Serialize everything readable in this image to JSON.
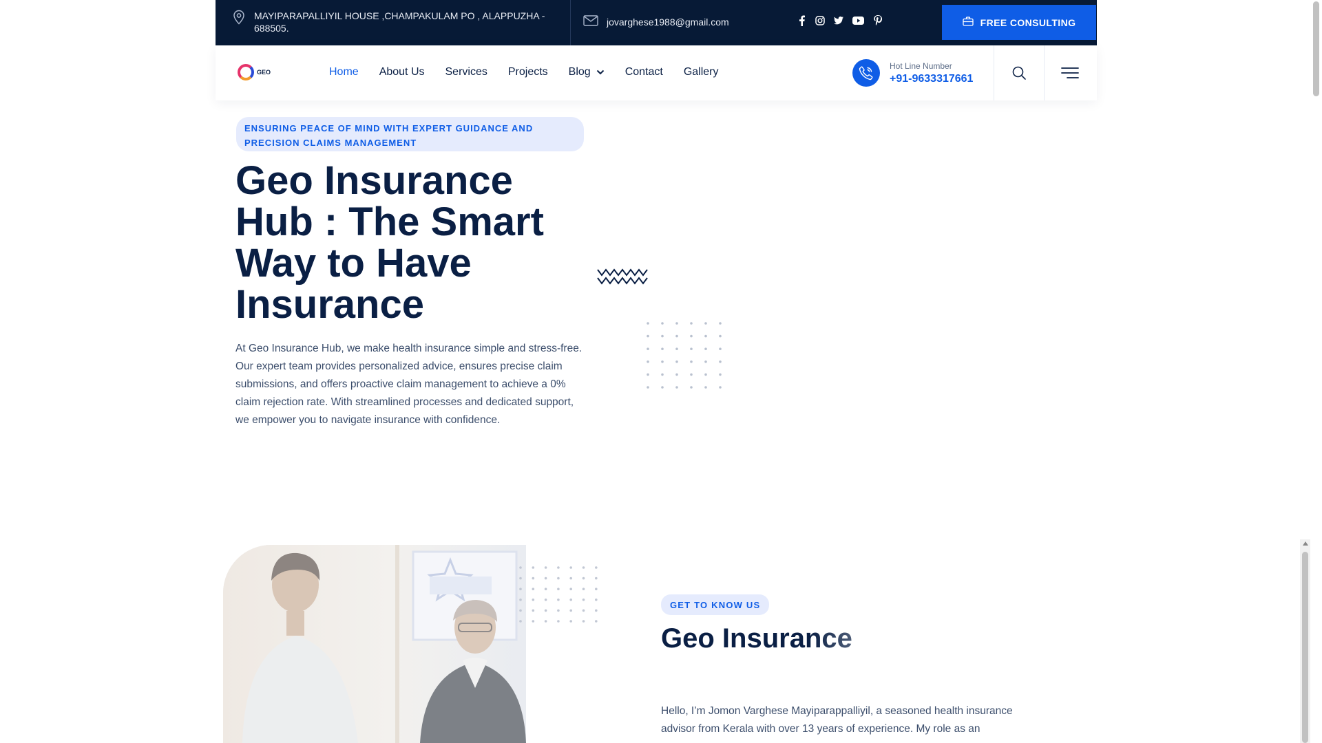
{
  "topbar": {
    "address": "MAYIPARAPALLIYIL HOUSE ,CHAMPAKULAM PO , ALAPPUZHA - 688505.",
    "email": "jovarghese1988@gmail.com",
    "social_icons": [
      "facebook-icon",
      "instagram-icon",
      "twitter-icon",
      "youtube-icon",
      "pinterest-icon"
    ],
    "cta_label": "FREE CONSULTING"
  },
  "header": {
    "logo_text": "GEO",
    "nav": [
      {
        "label": "Home",
        "active": true
      },
      {
        "label": "About Us"
      },
      {
        "label": "Services"
      },
      {
        "label": "Projects"
      },
      {
        "label": "Blog",
        "has_dropdown": true
      },
      {
        "label": "Contact"
      },
      {
        "label": "Gallery"
      }
    ],
    "hotline_label": "Hot Line Number",
    "hotline_number": "+91-9633317661"
  },
  "hero": {
    "tag": "ENSURING PEACE OF MIND WITH EXPERT GUIDANCE AND PRECISION CLAIMS MANAGEMENT",
    "title": "Geo Insurance Hub : The Smart Way to Have Insurance",
    "description": "At Geo Insurance Hub, we make health insurance simple and stress-free. Our expert team provides personalized advice, ensures precise claim submissions, and offers proactive claim management to achieve a 0% claim rejection rate. With streamlined processes and dedicated support, we empower you to navigate insurance with confidence."
  },
  "about": {
    "tag": "GET TO KNOW US",
    "title": "Geo Insurance",
    "description": "Hello, I’m Jomon Varghese Mayiparappalliyil, a seasoned health insurance advisor from Kerala with over 13 years of experience. My role as an"
  },
  "colors": {
    "navy": "#071a36",
    "brand_blue": "#0f5de6",
    "heading": "#0a1f44",
    "pill_bg": "#e5ebfd"
  }
}
